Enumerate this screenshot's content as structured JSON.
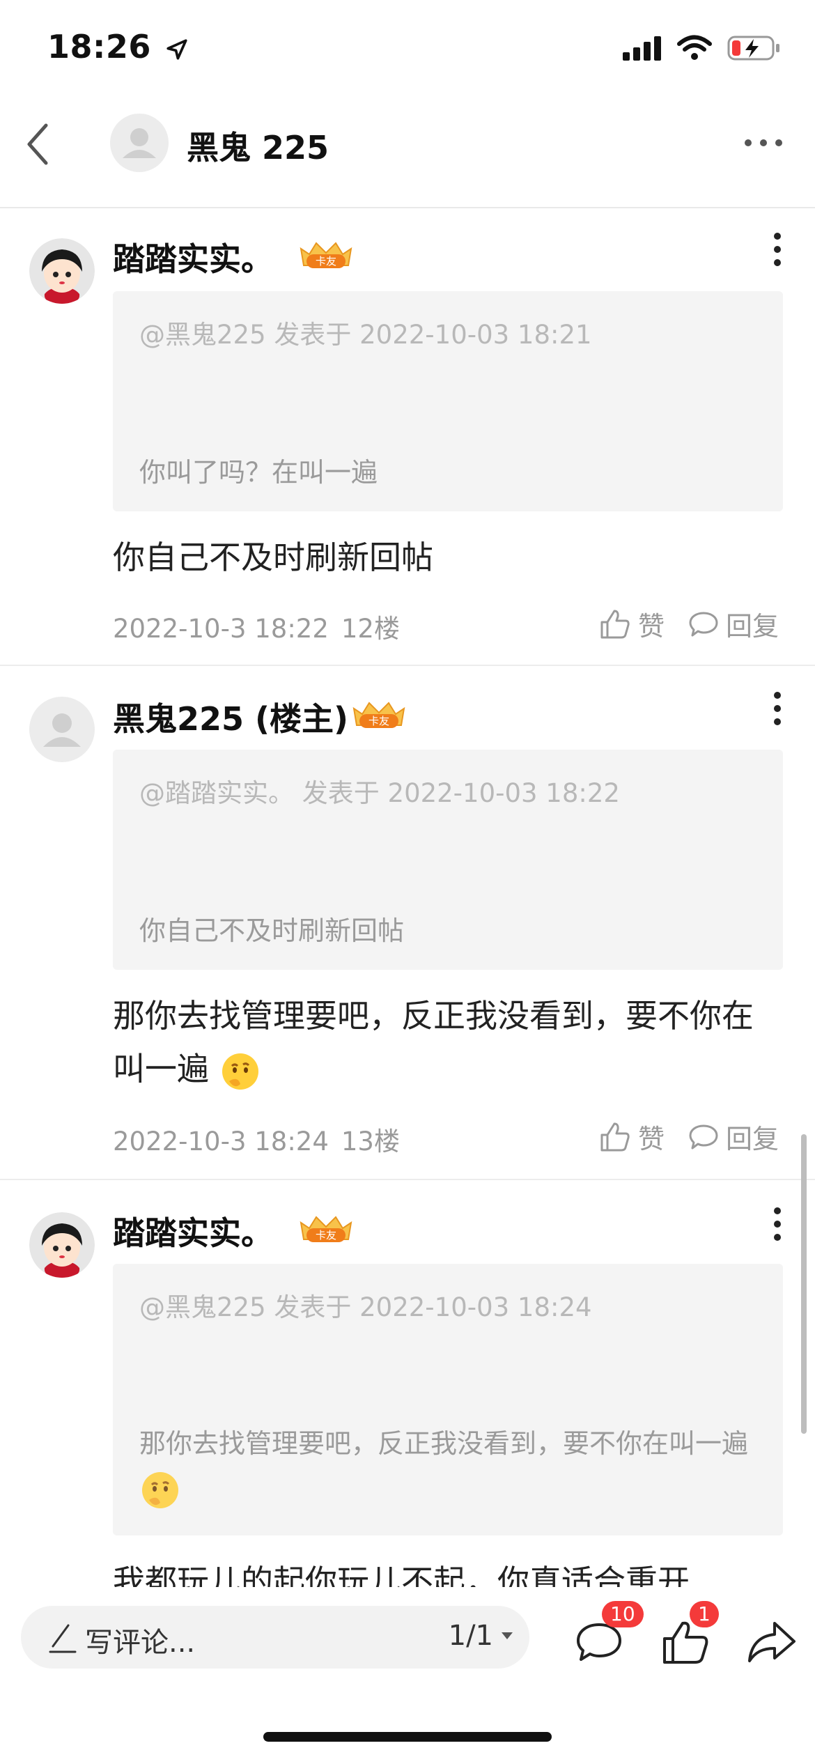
{
  "status_bar": {
    "time": "18:26"
  },
  "nav": {
    "title": "黑鬼 225"
  },
  "comments": [
    {
      "user": "踏踏实实。",
      "badge": "卡友",
      "quote_header": "@黑鬼225 发表于 2022-10-03 18:21",
      "quote_text": "你叫了吗？在叫一遍",
      "text": "你自己不及时刷新回帖",
      "date": "2022-10-3 18:22",
      "floor": "12楼",
      "like_label": "赞",
      "reply_label": "回复"
    },
    {
      "user": "黑鬼225 (楼主)",
      "badge": "卡友",
      "quote_header": "@踏踏实实。 发表于 2022-10-03 18:22",
      "quote_text": "你自己不及时刷新回帖",
      "text": "那你去找管理要吧，反正我没看到，要不你在叫一遍",
      "date": "2022-10-3 18:24",
      "floor": "13楼",
      "like_label": "赞",
      "reply_label": "回复"
    },
    {
      "user": "踏踏实实。",
      "badge": "卡友",
      "quote_header": "@黑鬼225 发表于 2022-10-03 18:24",
      "quote_text": "那你去找管理要吧，反正我没看到，要不你在叫一遍",
      "text": "我都玩儿的起你玩儿不起，你真适合重开"
    }
  ],
  "bottom_bar": {
    "composer_placeholder": "写评论...",
    "page_indicator": "1/1",
    "comment_count": "10",
    "like_count": "1"
  },
  "colors": {
    "badge_red": "#f43a3a",
    "quote_bg": "#f4f4f4",
    "muted_text": "#9a9a9a"
  },
  "icons": [
    "back-chevron-icon",
    "more-horizontal-icon",
    "more-vertical-icon",
    "thumbs-up-icon",
    "comment-bubble-icon",
    "pencil-icon",
    "share-arrow-icon",
    "wifi-icon",
    "signal-icon",
    "battery-icon",
    "location-arrow-icon"
  ]
}
